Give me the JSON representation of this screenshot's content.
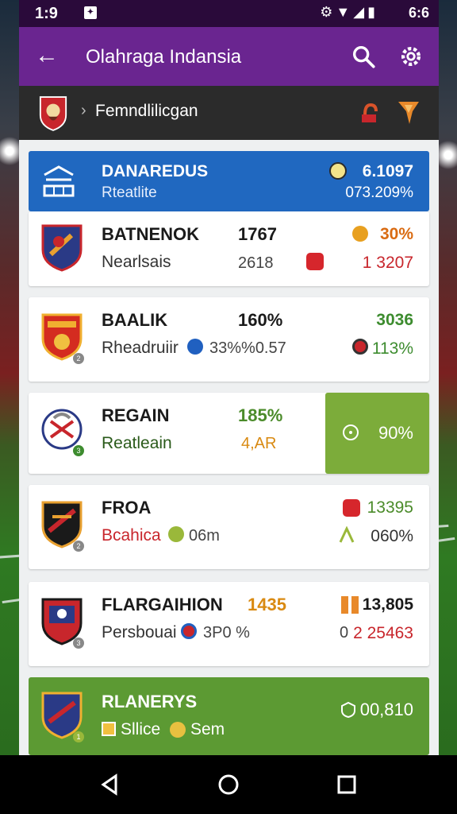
{
  "status_bar": {
    "time": "1:9",
    "right_text": "6:6",
    "icons": [
      "settings-icon",
      "wifi-icon",
      "signal-icon",
      "battery-icon"
    ]
  },
  "app_bar": {
    "title": "Olahraga Indansia"
  },
  "league_bar": {
    "name": "Femndlilicgan"
  },
  "header_card": {
    "name": "DANAREDUS",
    "subtitle": "Rteatlite",
    "value1": "6.1097",
    "value2": "073.209%",
    "color": "#2068c0"
  },
  "rows": [
    {
      "name": "BATNENOK",
      "sub": "Nearlsais",
      "n1": "1767",
      "n2": "2618",
      "v1": "30%",
      "v2": "1 3207",
      "v1_color": "#d96b12",
      "v2_color": "#c8262c"
    },
    {
      "name": "BAALIK",
      "sub": "Rheadruiir",
      "n1": "160%",
      "n2": "33%%0.57",
      "v1": "3036",
      "v2": "113%",
      "v1_color": "#3d8c2f",
      "v2_color": "#3d8c2f"
    },
    {
      "name": "REGAIN",
      "sub": "Reatleain",
      "n1": "185%",
      "n2": "4,AR",
      "v1": "90%",
      "n1_color": "#4b8b2a",
      "n2_color": "#d98a12"
    },
    {
      "name": "FROA",
      "sub": "Bcahica",
      "n2": "06m",
      "v1": "13395",
      "v2": "060%",
      "v1_color": "#4b8b2a",
      "sub_color": "#c8262c"
    },
    {
      "name": "FLARGAIHION",
      "sub": "Persbouai",
      "n1": "1435",
      "n2": "3P0 %",
      "v1": "13,805",
      "v2": "2 25463",
      "n1_color": "#d98a12",
      "v2_color": "#c8262c",
      "v2_prefix": "0"
    },
    {
      "name": "RLANERYS",
      "sub": "Sllice",
      "n2": "Sem",
      "v1": "00,810",
      "bg": "#5c9a33"
    }
  ],
  "colors": {
    "purple": "#6a2590",
    "dark": "#2b2b2b",
    "green": "#7cac3a",
    "blue": "#2068c0"
  }
}
